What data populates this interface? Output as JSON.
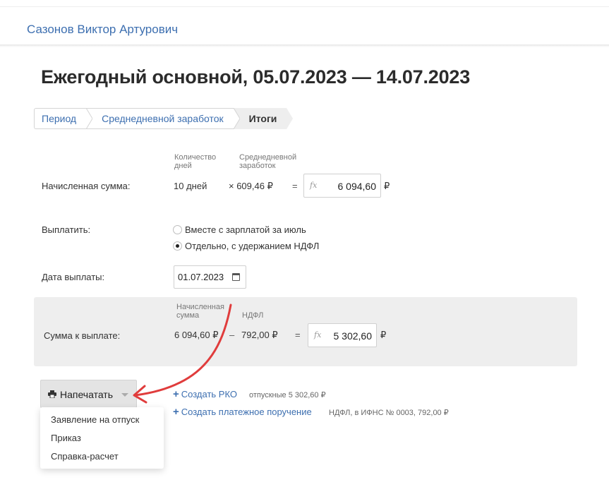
{
  "header": {
    "employee_name": "Сазонов Виктор Артурович"
  },
  "page": {
    "title": "Ежегодный основной, 05.07.2023 — 14.07.2023"
  },
  "steps": [
    {
      "label": "Период",
      "active": false
    },
    {
      "label": "Среднедневной заработок",
      "active": false
    },
    {
      "label": "Итоги",
      "active": true
    }
  ],
  "accrued": {
    "label": "Начисленная сумма:",
    "days_header": "Количество дней",
    "avg_header": "Среднедневной заработок",
    "days_value": "10 дней",
    "avg_value": "× 609,46 ₽",
    "equals": "=",
    "fx": "fx",
    "total": "6 094,60",
    "currency": "₽"
  },
  "payout": {
    "label": "Выплатить:",
    "options": [
      {
        "label": "Вместе с зарплатой за июль",
        "checked": false
      },
      {
        "label": "Отдельно, с удержанием НДФЛ",
        "checked": true
      }
    ]
  },
  "pay_date": {
    "label": "Дата выплаты:",
    "value": "01.07.2023"
  },
  "payable": {
    "label": "Сумма к выплате:",
    "accrued_header": "Начисленная сумма",
    "tax_header": "НДФЛ",
    "accrued_value": "6 094,60 ₽",
    "minus": "–",
    "tax_value": "792,00 ₽",
    "equals": "=",
    "fx": "fx",
    "total": "5 302,60",
    "currency": "₽"
  },
  "print": {
    "label": "Напечатать",
    "menu": [
      "Заявление на отпуск",
      "Приказ",
      "Справка-расчет"
    ]
  },
  "actions": {
    "create_rko": "Создать РКО",
    "rko_note": "отпускные 5 302,60 ₽",
    "create_payment_order": "Создать платежное поручение",
    "payment_note": "НДФЛ, в ИФНС № 0003, 792,00 ₽"
  },
  "colors": {
    "link": "#3d6fb0",
    "annotation_arrow": "#e03c3c",
    "panel": "#eeeeee"
  }
}
